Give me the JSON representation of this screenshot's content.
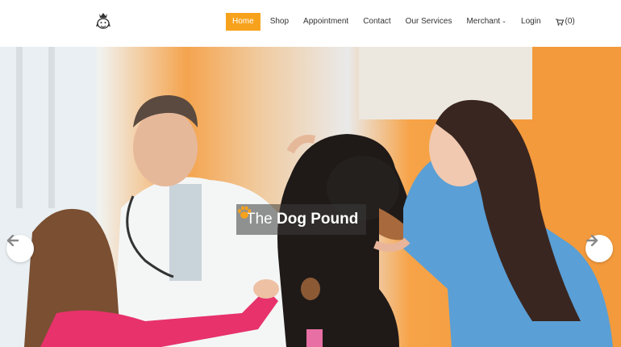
{
  "header": {
    "logo": "crowned-dog-logo",
    "nav": [
      {
        "label": "Home",
        "active": true
      },
      {
        "label": "Shop"
      },
      {
        "label": "Appointment"
      },
      {
        "label": "Contact"
      },
      {
        "label": "Our Services"
      },
      {
        "label": "Merchant",
        "dropdown": true
      },
      {
        "label": "Login"
      }
    ],
    "cart": {
      "icon": "cart-icon",
      "count": "(0)"
    }
  },
  "hero": {
    "brand_prefix": "The",
    "brand_name": "Dog Pound",
    "brand_icon": "paw-icon",
    "prev_icon": "arrow-left-icon",
    "next_icon": "arrow-right-icon"
  },
  "colors": {
    "accent": "#f7a21d",
    "text": "#333333"
  }
}
